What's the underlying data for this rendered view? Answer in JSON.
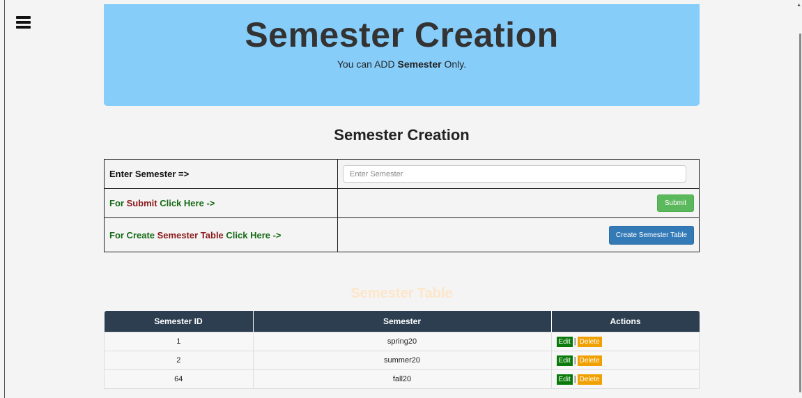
{
  "menu": {
    "icon": "hamburger-menu-icon"
  },
  "header": {
    "title": "Semester Creation",
    "subtitle_prefix": "You can ADD ",
    "subtitle_bold": "Semester",
    "subtitle_suffix": " Only."
  },
  "form": {
    "title": "Semester Creation",
    "row1_label": "Enter Semester =>",
    "semester_input": {
      "placeholder": "Enter Semester",
      "value": ""
    },
    "row2_label_a": "For ",
    "row2_label_b": "Submit",
    "row2_label_c": " Click Here ->",
    "submit_label": "Submit",
    "row3_label_a": "For Create ",
    "row3_label_b": "Semester Table",
    "row3_label_c": " Click Here ->",
    "create_table_label": "Create Semester Table"
  },
  "table": {
    "title": "Semester Table",
    "headers": [
      "Semester ID",
      "Semester",
      "Actions"
    ],
    "rows": [
      {
        "id": "1",
        "semester": "spring20"
      },
      {
        "id": "2",
        "semester": "summer20"
      },
      {
        "id": "64",
        "semester": "fall20"
      }
    ],
    "edit_label": "Edit",
    "separator": "|",
    "delete_label": "Delete"
  },
  "colors": {
    "header_bg": "#87cdfa",
    "table_header_bg": "#2c3e50",
    "submit_green": "#5cb85c",
    "create_blue": "#337ab7",
    "edit_green": "#0a7a0a",
    "delete_orange": "#f0a000"
  }
}
